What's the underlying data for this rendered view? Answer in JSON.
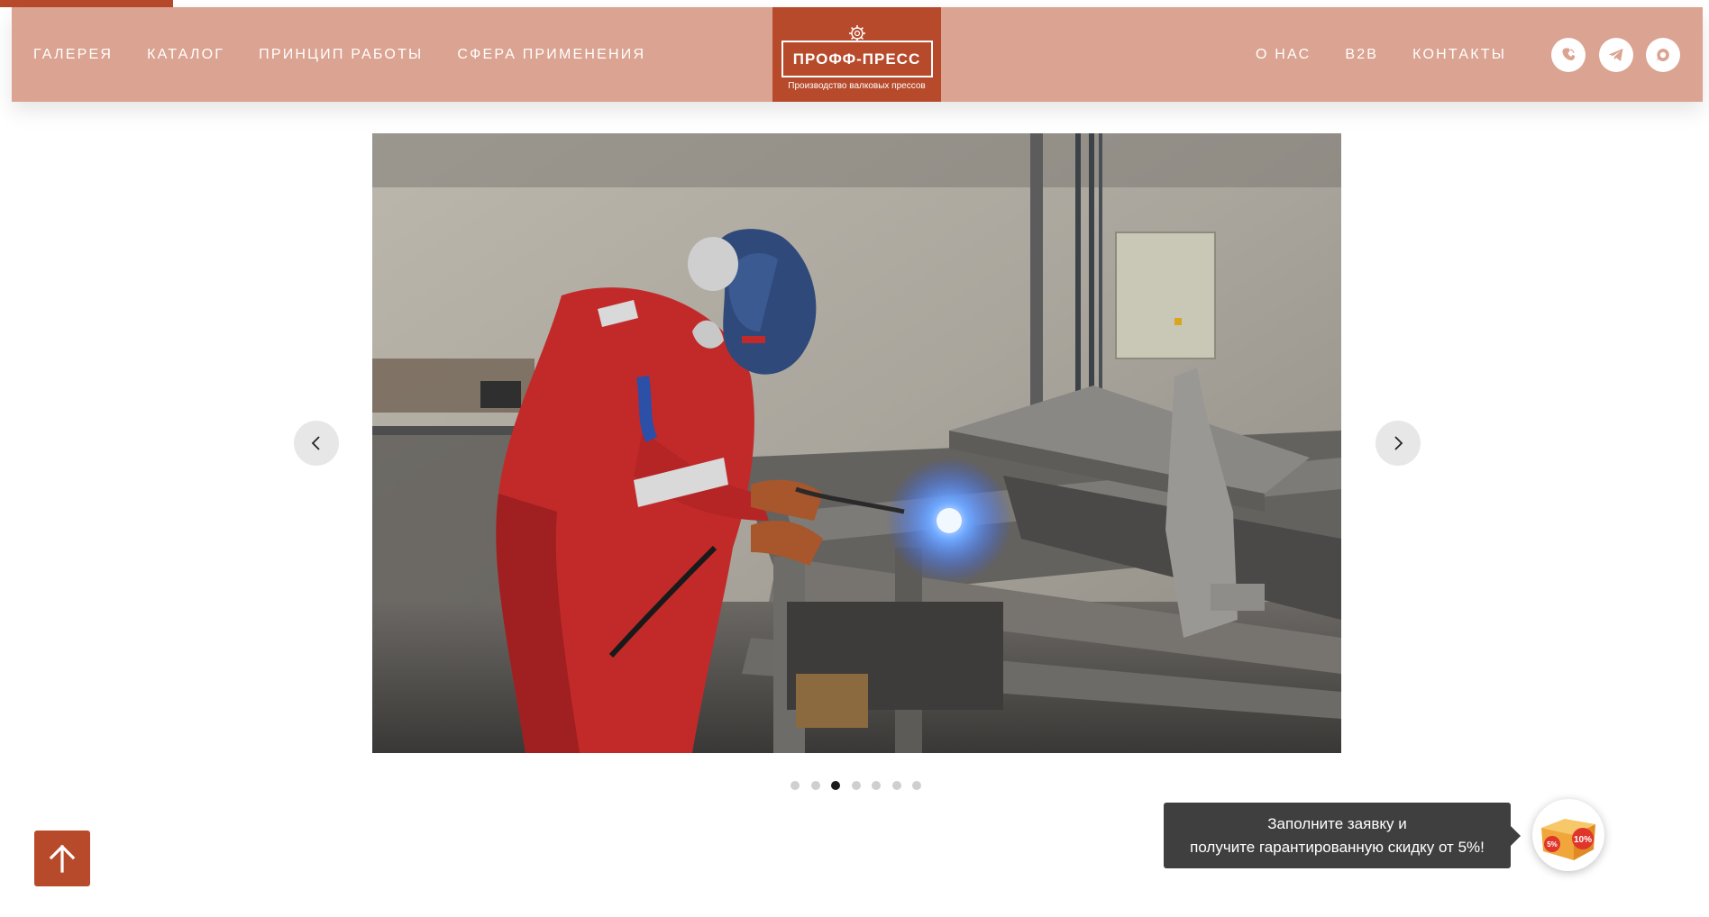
{
  "nav_left": [
    "ГАЛЕРЕЯ",
    "КАТАЛОГ",
    "ПРИНЦИП РАБОТЫ",
    "СФЕРА ПРИМЕНЕНИЯ"
  ],
  "nav_right": [
    "О НАС",
    "B2B",
    "КОНТАКТЫ"
  ],
  "logo": {
    "title": "ПРОФФ-ПРЕСС",
    "subtitle": "Производство валковых прессов"
  },
  "social_icons": [
    "viber-icon",
    "telegram-icon",
    "chat-icon"
  ],
  "slider": {
    "dots_count": 7,
    "active_dot": 3
  },
  "promo": {
    "line1": "Заполните заявку и",
    "line2": "получите гарантированную скидку от 5%!",
    "badge_left": "5%",
    "badge_right": "10%"
  },
  "colors": {
    "header_bg": "#dba391",
    "brand": "#b84a2c",
    "promo_bg": "#3f3f3f"
  }
}
